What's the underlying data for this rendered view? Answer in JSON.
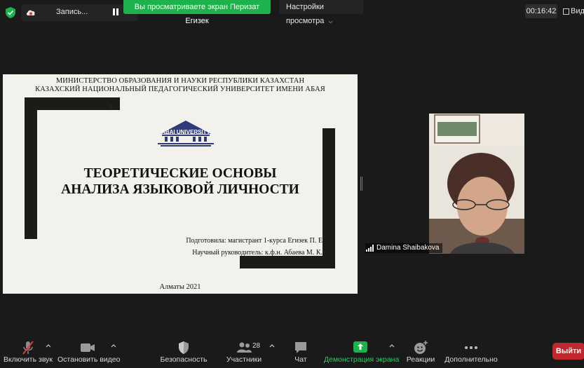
{
  "top_bar": {
    "recording_label": "Запись...",
    "banner": "Вы просматриваете экран Перизат Егизек",
    "view_options": "Настройки просмотра",
    "timer": "00:16:42",
    "view_label": "Вид"
  },
  "slide": {
    "ministry_line1": "МИНИСТЕРСТВО ОБРАЗОВАНИЯ И НАУКИ РЕСПУБЛИКИ КАЗАХСТАН",
    "ministry_line2": "КАЗАХСКИЙ НАЦИОНАЛЬНЫЙ ПЕДАГОГИЧЕСКИЙ УНИВЕРСИТЕТ ИМЕНИ АБАЯ",
    "logo_text": "ABAI UNIVERSITY",
    "title_line1": "ТЕОРЕТИЧЕСКИЕ ОСНОВЫ",
    "title_line2": "АНАЛИЗА ЯЗЫКОВОЙ ЛИЧНОСТИ",
    "prepared_by": "Подготовила: магистрант 1-курса Егизек П. Е",
    "supervisor": "Научный руководитель: к.ф.н. Абаева М. К.",
    "city_year": "Алматы 2021",
    "bar_color": "#1a1c16",
    "background": "#f3f1ec"
  },
  "video": {
    "participant_name": "Damina Shaibakova"
  },
  "toolbar": {
    "mute_label": "Включить звук",
    "video_label": "Остановить видео",
    "security_label": "Безопасность",
    "participants_label": "Участники",
    "participants_count": "28",
    "chat_label": "Чат",
    "share_label": "Демонстрация экрана",
    "reactions_label": "Реакции",
    "more_label": "Дополнительно",
    "leave_label": "Выйти",
    "share_color": "#1fd15a",
    "leave_color": "#c0282d"
  }
}
